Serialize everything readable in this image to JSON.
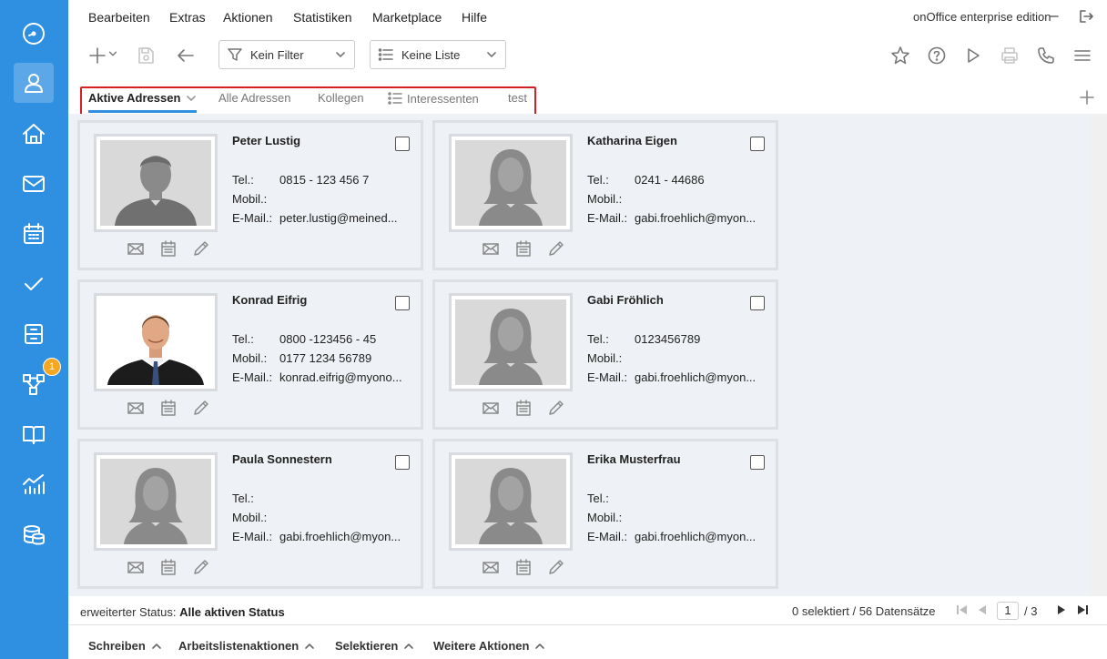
{
  "app": {
    "edition": "onOffice enterprise edition"
  },
  "menu": [
    "Bearbeiten",
    "Extras",
    "Aktionen",
    "Statistiken",
    "Marketplace",
    "Hilfe"
  ],
  "toolbar": {
    "filter": "Kein Filter",
    "list": "Keine Liste"
  },
  "sidebar": {
    "items": [
      "dashboard-icon",
      "addresses-icon",
      "properties-icon",
      "email-icon",
      "calendar-icon",
      "tasks-icon",
      "files-icon",
      "process-icon",
      "knowledge-icon",
      "statistics-icon",
      "database-icon"
    ],
    "active": "addresses-icon",
    "badge": "1",
    "accent": "#2f8fe0"
  },
  "tabs": [
    {
      "label": "Aktive Adressen",
      "active": true
    },
    {
      "label": "Alle Adressen",
      "active": false
    },
    {
      "label": "Kollegen",
      "active": false
    },
    {
      "label": "Interessenten",
      "active": false
    },
    {
      "label": "test",
      "active": false
    }
  ],
  "cards": [
    {
      "name": "Peter Lustig",
      "tel": "0815 - 123 456 7",
      "mobil": "",
      "email": "peter.lustig@meined...",
      "photo": "male-placeholder"
    },
    {
      "name": "Katharina Eigen",
      "tel": "0241 - 44686",
      "mobil": "",
      "email": "gabi.froehlich@myon...",
      "photo": "female-placeholder"
    },
    {
      "name": "Konrad Eifrig",
      "tel": "0800 -123456 - 45",
      "mobil": "0177 1234 56789",
      "email": "konrad.eifrig@myono...",
      "photo": "businessman-photo"
    },
    {
      "name": "Gabi Fröhlich",
      "tel": "0123456789",
      "mobil": "",
      "email": "gabi.froehlich@myon...",
      "photo": "female-placeholder"
    },
    {
      "name": "Paula Sonnestern",
      "tel": "",
      "mobil": "",
      "email": "gabi.froehlich@myon...",
      "photo": "female-placeholder"
    },
    {
      "name": "Erika Musterfrau",
      "tel": "",
      "mobil": "",
      "email": "gabi.froehlich@myon...",
      "photo": "female-placeholder"
    }
  ],
  "labels": {
    "tel": "Tel.:",
    "mobil": "Mobil.:",
    "email": "E-Mail.:"
  },
  "status": {
    "prefix": "erweiterter Status:",
    "value": "Alle aktiven Status",
    "count": "0 selektiert / 56 Datensätze",
    "page": "1",
    "total": "/ 3"
  },
  "bottom": [
    "Schreiben",
    "Arbeitslistenaktionen",
    "Selektieren",
    "Weitere Aktionen"
  ]
}
